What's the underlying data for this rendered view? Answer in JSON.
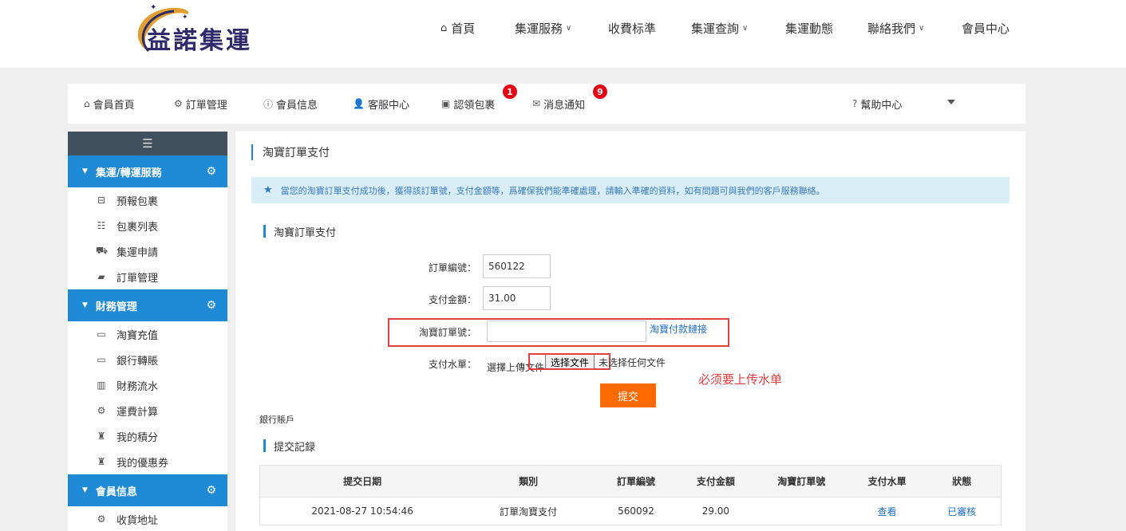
{
  "header": {
    "logo_text": "益諾集運",
    "nav": [
      {
        "label": "首頁",
        "icon": "home-icon"
      },
      {
        "label": "集運服務",
        "dropdown": true
      },
      {
        "label": "收費标準"
      },
      {
        "label": "集運查詢",
        "dropdown": true
      },
      {
        "label": "集運動態"
      },
      {
        "label": "聯絡我們",
        "dropdown": true
      },
      {
        "label": "會員中心"
      }
    ]
  },
  "memberbar": {
    "items": [
      {
        "label": "會員首頁",
        "icon": "home-icon"
      },
      {
        "label": "訂單管理",
        "icon": "gear-icon"
      },
      {
        "label": "會員信息",
        "icon": "info-icon"
      },
      {
        "label": "客服中心",
        "icon": "user-icon"
      },
      {
        "label": "認領包裹",
        "icon": "box-icon",
        "badge": "1"
      },
      {
        "label": "消息通知",
        "icon": "envelope-icon",
        "badge": "9"
      }
    ],
    "help": {
      "label": "幫助中心",
      "icon": "question-icon"
    }
  },
  "sidebar": {
    "groups": [
      {
        "title": "集運/轉運服務",
        "items": [
          {
            "label": "預報包裹",
            "icon": "inbox-icon"
          },
          {
            "label": "包裹列表",
            "icon": "list-icon"
          },
          {
            "label": "集運申請",
            "icon": "truck-icon"
          },
          {
            "label": "訂單管理",
            "icon": "book-icon"
          }
        ]
      },
      {
        "title": "財務管理",
        "items": [
          {
            "label": "淘寶充值",
            "icon": "credit-card-icon"
          },
          {
            "label": "銀行轉賬",
            "icon": "credit-card-icon"
          },
          {
            "label": "財務流水",
            "icon": "bar-chart-icon"
          },
          {
            "label": "運費計算",
            "icon": "cogs-icon"
          },
          {
            "label": "我的積分",
            "icon": "gift-icon"
          },
          {
            "label": "我的優惠券",
            "icon": "gift-icon"
          }
        ]
      },
      {
        "title": "會員信息",
        "items": [
          {
            "label": "收貨地址",
            "icon": "cogs-icon"
          }
        ]
      }
    ]
  },
  "main": {
    "page_title": "淘寶訂單支付",
    "alert": "當您的淘寶訂單支付成功後，獲得該訂單號，支付金額等，爲確保我們能準確處理，請輸入準確的資料，如有問題可與我們的客戶服務聯絡。",
    "form_section_title": "淘寶訂單支付",
    "form": {
      "order_no_label": "訂單編號：",
      "order_no_value": "560122",
      "amount_label": "支付金額：",
      "amount_value": "31.00",
      "taobao_no_label": "淘寶訂單號：",
      "taobao_no_value": "",
      "taobao_link": "淘寶付款鏈接",
      "receipt_label": "支付水單：",
      "receipt_hint": "選擇上傳文件",
      "file_button": "选择文件",
      "file_status": "未选择任何文件",
      "submit": "提交"
    },
    "annotation": "必须要上传水单",
    "bank_account": "銀行賬戶",
    "records_title": "提交記録",
    "table": {
      "headers": [
        "提交日期",
        "類別",
        "訂單編號",
        "支付金額",
        "淘寶訂單號",
        "支付水單",
        "狀態"
      ],
      "rows": [
        [
          "2021-08-27 10:54:46",
          "訂單淘寶支付",
          "560092",
          "29.00",
          "",
          "查看",
          "已審核"
        ]
      ]
    }
  }
}
